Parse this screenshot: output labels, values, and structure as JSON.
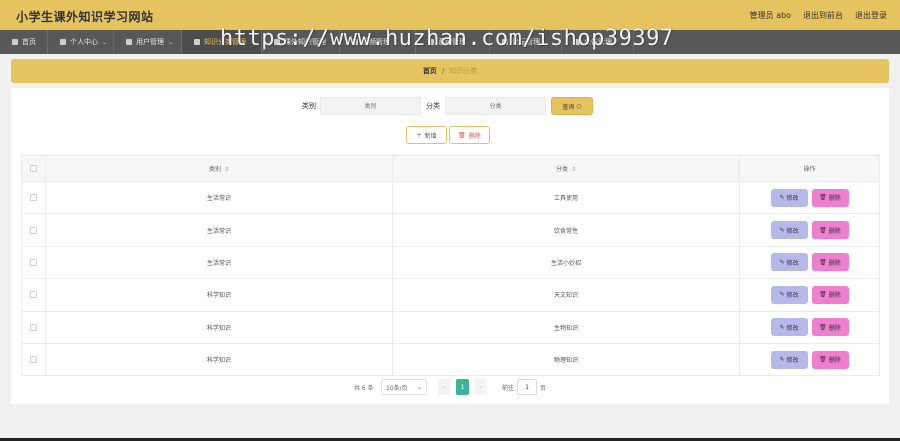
{
  "header": {
    "title": "小学生课外知识学习网站",
    "user_label": "管理员 abo",
    "back_label": "退出到前台",
    "logout_label": "退出登录"
  },
  "nav": {
    "items": [
      {
        "label": "首页",
        "active": false,
        "icon": "home-icon",
        "dropdown": false
      },
      {
        "label": "个人中心",
        "active": false,
        "icon": "person-icon",
        "dropdown": true
      },
      {
        "label": "用户管理",
        "active": false,
        "icon": "document-icon",
        "dropdown": true
      },
      {
        "label": "知识分类管理",
        "active": true,
        "icon": "document-icon",
        "dropdown": true
      },
      {
        "label": "课外知识管理",
        "active": false,
        "icon": "document-icon",
        "dropdown": true
      },
      {
        "label": "视频管理",
        "active": false,
        "icon": "document-icon",
        "dropdown": true
      },
      {
        "label": "系统管理",
        "active": false,
        "icon": "document-icon",
        "dropdown": true
      },
      {
        "label": "论坛管理",
        "active": false,
        "icon": "document-icon",
        "dropdown": true
      },
      {
        "label": "公告管理",
        "active": false,
        "icon": "document-icon",
        "dropdown": true
      }
    ]
  },
  "watermark": "https://www.huzhan.com/ishop39397",
  "breadcrumb": {
    "home": "首页",
    "separator": "/",
    "current": "知识分类"
  },
  "search": {
    "category_label": "类别",
    "category_placeholder": "类别",
    "subcategory_label": "分类",
    "subcategory_placeholder": "分类",
    "query_label": "查询",
    "query_icon": "search-icon"
  },
  "actions": {
    "add_label": "新增",
    "add_icon": "plus-icon",
    "delete_label": "删除",
    "delete_icon": "trash-icon"
  },
  "table": {
    "columns": [
      "类别",
      "分类",
      "操作"
    ],
    "rows": [
      {
        "category": "生活常识",
        "subcategory": "工具使用"
      },
      {
        "category": "生活常识",
        "subcategory": "饮食常性"
      },
      {
        "category": "生活常识",
        "subcategory": "生活小妙招"
      },
      {
        "category": "科学知识",
        "subcategory": "天文知识"
      },
      {
        "category": "科学知识",
        "subcategory": "生物知识"
      },
      {
        "category": "科学知识",
        "subcategory": "物理知识"
      }
    ],
    "edit_label": "修改",
    "edit_icon": "pencil-icon",
    "remove_label": "删除",
    "remove_icon": "trash-icon",
    "colors": {
      "edit": "#b5b8e8",
      "remove": "#ee7fcf"
    }
  },
  "pagination": {
    "total_label": "共 6 条",
    "page_size": "10条/页",
    "current_page": "1",
    "goto_label": "前往",
    "goto_value": "1",
    "unit": "页"
  },
  "colors": {
    "accent": "#e5c35f",
    "nav": "#585858",
    "page_active": "#3bb39a"
  }
}
